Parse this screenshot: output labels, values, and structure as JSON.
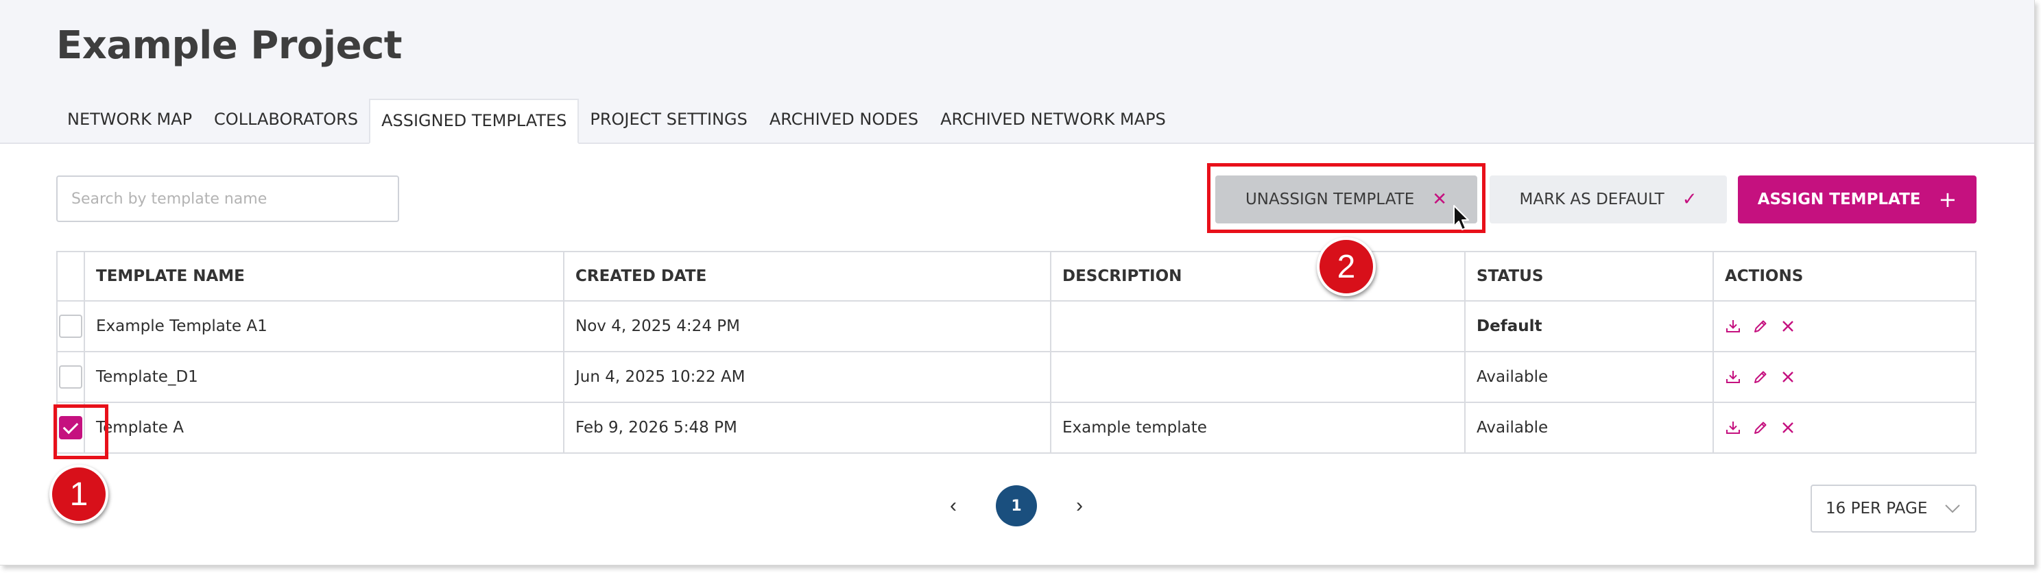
{
  "project": {
    "title": "Example Project"
  },
  "tabs": [
    {
      "label": "NETWORK MAP",
      "active": false
    },
    {
      "label": "COLLABORATORS",
      "active": false
    },
    {
      "label": "ASSIGNED TEMPLATES",
      "active": true
    },
    {
      "label": "PROJECT SETTINGS",
      "active": false
    },
    {
      "label": "ARCHIVED NODES",
      "active": false
    },
    {
      "label": "ARCHIVED NETWORK MAPS",
      "active": false
    }
  ],
  "search": {
    "placeholder": "Search by template name",
    "value": ""
  },
  "toolbar": {
    "unassign_label": "UNASSIGN TEMPLATE",
    "unassign_icon": "close-icon",
    "default_label": "MARK AS DEFAULT",
    "default_icon": "check-icon",
    "assign_label": "ASSIGN TEMPLATE",
    "assign_icon": "plus-icon"
  },
  "table": {
    "headers": [
      "TEMPLATE NAME",
      "CREATED DATE",
      "DESCRIPTION",
      "STATUS",
      "ACTIONS"
    ],
    "rows": [
      {
        "checked": false,
        "name": "Example Template A1",
        "created": "Nov 4, 2025 4:24 PM",
        "description": "",
        "status": "Default"
      },
      {
        "checked": false,
        "name": "Template_D1",
        "created": "Jun 4, 2025 10:22 AM",
        "description": "",
        "status": "Available"
      },
      {
        "checked": true,
        "name": "Template A",
        "created": "Feb 9, 2026 5:48 PM",
        "description": "Example template",
        "status": "Available"
      }
    ]
  },
  "pagination": {
    "current_page": "1",
    "per_page": "16 PER PAGE"
  },
  "annotations": {
    "step1": "1",
    "step2": "2"
  },
  "colors": {
    "accent": "#c5117f",
    "page_active": "#1a4f7e",
    "highlight": "#e8101a"
  }
}
